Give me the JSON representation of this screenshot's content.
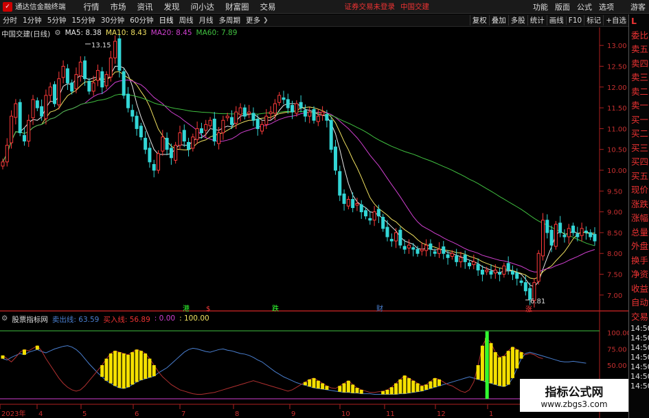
{
  "menubar": {
    "app_title": "通达信金融终端",
    "items": [
      "行情",
      "市场",
      "资讯",
      "发现",
      "问小达",
      "财富圈",
      "交易"
    ],
    "login_notice": "证券交易未登录",
    "stock_name": "中国交建",
    "right_items": [
      "功能",
      "版面",
      "公式",
      "选项",
      "游客"
    ]
  },
  "toolbar": {
    "periods": [
      "分时",
      "1分钟",
      "5分钟",
      "15分钟",
      "30分钟",
      "60分钟",
      "日线",
      "周线",
      "月线",
      "多周期",
      "更多"
    ],
    "active_period": "日线",
    "right_items": [
      "复权",
      "叠加",
      "多股",
      "统计",
      "画线",
      "F10",
      "标记",
      "+自选"
    ]
  },
  "main_header": {
    "title": "中国交建(日线)",
    "ma5": "MA5: 8.38",
    "ma10": "MA10: 8.43",
    "ma20": "MA20: 8.45",
    "ma60": "MA60: 7.89"
  },
  "sub_header": {
    "title": "股票指标网",
    "sell_line": "卖出线: 63.59",
    "buy_line": "买入线: 56.89",
    "v1": ": 0.00",
    "v2": ": 100.00"
  },
  "price_annotations": {
    "high": "13.15",
    "low": "6.81"
  },
  "event_markers": [
    "港",
    "$",
    "跌",
    "财",
    "涨"
  ],
  "price_axis": [
    "13.00",
    "12.50",
    "12.00",
    "11.50",
    "11.00",
    "10.50",
    "10.00",
    "9.50",
    "9.00",
    "8.50",
    "8.00",
    "7.50",
    "7.00"
  ],
  "indicator_axis": [
    "100.00",
    "75.00",
    "50.00",
    "25.00"
  ],
  "x_axis": [
    "2023年",
    "4",
    "5",
    "6",
    "7",
    "8",
    "9",
    "10",
    "11",
    "12",
    "1"
  ],
  "right_panel": {
    "items": [
      "委比",
      "卖五",
      "卖四",
      "卖三",
      "卖二",
      "卖一",
      "买一",
      "买二",
      "买三",
      "买四",
      "买五",
      "现价",
      "涨跌",
      "涨幅",
      "总量",
      "外盘",
      "换手",
      "净资",
      "收益",
      "自动",
      "交易"
    ],
    "times": [
      "14:50",
      "14:50",
      "14:50",
      "14:50",
      "14:50",
      "14:50",
      "14:50"
    ],
    "corner": "L"
  },
  "watermark": {
    "line1": "指标公式网",
    "line2": "www.zbgs3.com"
  },
  "colors": {
    "up": "#ff3b3b",
    "down": "#33d6d6",
    "ma5": "#e8e8e8",
    "ma10": "#f0e060",
    "ma20": "#d040d0",
    "ma60": "#40c040",
    "sell_line": "#4a7fd0",
    "buy_line": "#b03030",
    "signal": "#30ff30",
    "buy_zone": "#f5e000"
  },
  "chart_data": {
    "type": "candlestick",
    "price_range": [
      6.75,
      13.3
    ],
    "indicator_range": [
      -5,
      105
    ],
    "closes": [
      10.2,
      10.6,
      11.3,
      11.6,
      10.9,
      10.7,
      11.2,
      11.7,
      11.5,
      11.3,
      11.8,
      12.0,
      11.6,
      12.2,
      12.5,
      12.1,
      11.9,
      12.3,
      12.6,
      12.2,
      11.9,
      12.1,
      12.4,
      12.0,
      12.3,
      12.7,
      13.1,
      12.4,
      11.8,
      11.5,
      11.3,
      11.0,
      10.8,
      10.5,
      10.2,
      10.0,
      10.4,
      10.8,
      10.5,
      10.3,
      10.6,
      10.9,
      10.7,
      10.5,
      10.8,
      11.0,
      10.9,
      11.1,
      11.2,
      10.7,
      10.9,
      11.2,
      11.3,
      11.1,
      11.4,
      11.5,
      11.3,
      11.4,
      11.2,
      11.0,
      11.1,
      11.3,
      11.4,
      11.6,
      11.8,
      11.7,
      11.5,
      11.4,
      11.6,
      11.5,
      11.3,
      11.4,
      11.2,
      11.3,
      11.4,
      11.2,
      10.5,
      10.0,
      9.4,
      9.2,
      9.3,
      9.1,
      9.2,
      9.0,
      8.9,
      8.8,
      9.0,
      8.9,
      8.6,
      8.4,
      8.3,
      8.5,
      8.2,
      8.1,
      8.2,
      8.1,
      8.0,
      8.1,
      8.2,
      8.1,
      8.0,
      8.1,
      8.0,
      7.9,
      8.0,
      7.8,
      7.9,
      7.8,
      7.7,
      7.8,
      7.6,
      7.5,
      7.6,
      7.5,
      7.6,
      7.5,
      7.7,
      7.6,
      7.5,
      7.4,
      7.3,
      7.1,
      6.9,
      7.3,
      8.0,
      8.8,
      8.5,
      8.2,
      8.7,
      8.5,
      8.4,
      8.6,
      8.5,
      8.4,
      8.6,
      8.5,
      8.4,
      8.3
    ],
    "sell_line": [
      60,
      58,
      62,
      65,
      68,
      66,
      70,
      72,
      74,
      71,
      69,
      72,
      75,
      77,
      79,
      80,
      78,
      74,
      68,
      60,
      52,
      45,
      38,
      32,
      26,
      22,
      18,
      15,
      14,
      16,
      20,
      24,
      27,
      29,
      31,
      33,
      38,
      42,
      46,
      52,
      58,
      64,
      70,
      74,
      76,
      75,
      73,
      71,
      70,
      72,
      74,
      75,
      73,
      72,
      70,
      68,
      67,
      65,
      62,
      58,
      55,
      50,
      45,
      40,
      36,
      32,
      29,
      26,
      23,
      21,
      19,
      17,
      15,
      14,
      13,
      12,
      11,
      10,
      9,
      8,
      8,
      7,
      7,
      6,
      6,
      6,
      5,
      5,
      5,
      5,
      5,
      5,
      6,
      6,
      7,
      8,
      9,
      10,
      12,
      14,
      16,
      18,
      20,
      22,
      24,
      26,
      28,
      30,
      32,
      30,
      28,
      26,
      24,
      22,
      20,
      18,
      17,
      20,
      30,
      45,
      60,
      68,
      70,
      68,
      66,
      64,
      62,
      60,
      58,
      56,
      55,
      55,
      56,
      55,
      54,
      53
    ],
    "buy_line": [
      65,
      60,
      55,
      62,
      70,
      74,
      72,
      76,
      80,
      72,
      60,
      50,
      40,
      30,
      22,
      16,
      12,
      10,
      12,
      18,
      26,
      34,
      42,
      50,
      60,
      68,
      72,
      70,
      68,
      66,
      70,
      74,
      72,
      68,
      60,
      50,
      40,
      32,
      26,
      20,
      16,
      12,
      10,
      8,
      6,
      5,
      5,
      6,
      7,
      8,
      10,
      12,
      14,
      16,
      18,
      20,
      22,
      24,
      26,
      24,
      22,
      20,
      18,
      16,
      14,
      12,
      10,
      12,
      16,
      20,
      24,
      28,
      30,
      26,
      22,
      18,
      15,
      14,
      18,
      22,
      26,
      20,
      15,
      12,
      10,
      8,
      8,
      9,
      10,
      12,
      16,
      22,
      28,
      34,
      30,
      26,
      22,
      18,
      20,
      25,
      30,
      28,
      24,
      20,
      18,
      14,
      10,
      8,
      12,
      24,
      50,
      80,
      92,
      84,
      70,
      62,
      64,
      72,
      78,
      74,
      70,
      66,
      68,
      66,
      62,
      60
    ]
  }
}
